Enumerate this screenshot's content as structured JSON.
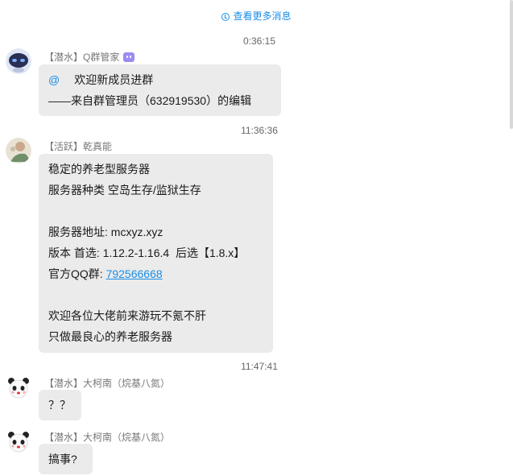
{
  "load_more": "查看更多消息",
  "messages": [
    {
      "time": "0:36:15",
      "sender_tag": "【潜水】",
      "sender_name": "Q群管家",
      "avatar": "robot-avatar-icon",
      "lines": [
        "欢迎新成员进群",
        "——来自群管理员（632919530）的编辑"
      ],
      "at_symbol": "@"
    },
    {
      "time": "11:36:36",
      "sender_tag": "【活跃】",
      "sender_name": "乾真能",
      "avatar": "user-photo-avatar-icon",
      "lines": [
        "稳定的养老型服务器",
        "服务器种类 空岛生存/监狱生存",
        "",
        "服务器地址: mcxyz.xyz",
        "版本 首选: 1.12.2-1.16.4  后选【1.8.x】",
        "官方QQ群: ",
        "",
        "欢迎各位大佬前来游玩不氪不肝",
        "只做最良心的养老服务器"
      ],
      "qq_group_link": "792566668"
    },
    {
      "time": "11:47:41",
      "sender_tag": "【潜水】",
      "sender_name": "大柯南（烷基八氮）",
      "avatar": "panda-avatar-icon",
      "lines": [
        "？？"
      ]
    },
    {
      "sender_tag": "【潜水】",
      "sender_name": "大柯南（烷基八氮）",
      "avatar": "panda-avatar-icon",
      "lines": [
        "搞事?"
      ]
    }
  ]
}
